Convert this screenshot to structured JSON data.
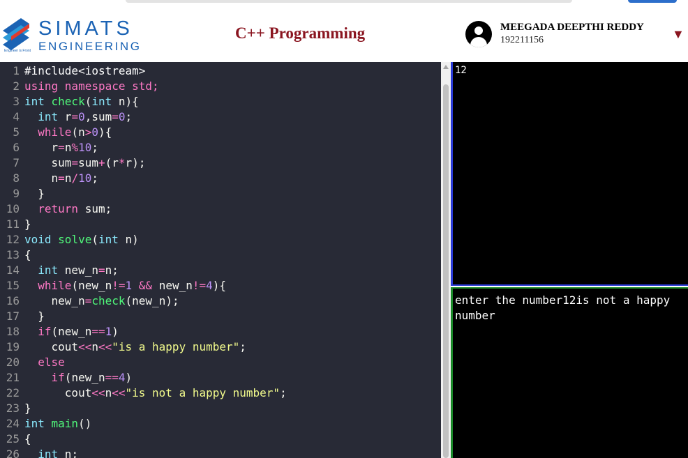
{
  "header": {
    "brand": "SIMATS",
    "brand_sub": "ENGINEERING",
    "tagline": "Engineer is Front",
    "title": "C++ Programming",
    "user_name": "MEEGADA DEEPTHI REDDY",
    "user_id": "192211156",
    "caret": "▼"
  },
  "editor": {
    "lines": [
      [
        [
          "#include<iostream>",
          "pp"
        ]
      ],
      [
        [
          "using namespace std;",
          "k"
        ]
      ],
      [
        [
          "int ",
          "t"
        ],
        [
          "check",
          "f"
        ],
        [
          "(",
          "w"
        ],
        [
          "int ",
          "t"
        ],
        [
          "n",
          "w"
        ],
        [
          "){",
          "w"
        ]
      ],
      [
        [
          "  int ",
          "t"
        ],
        [
          "r",
          "w"
        ],
        [
          "=",
          "k"
        ],
        [
          "0",
          "n"
        ],
        [
          ",",
          "w"
        ],
        [
          "sum",
          "w"
        ],
        [
          "=",
          "k"
        ],
        [
          "0",
          "n"
        ],
        [
          ";",
          "w"
        ]
      ],
      [
        [
          "  while",
          "k"
        ],
        [
          "(",
          "w"
        ],
        [
          "n",
          "w"
        ],
        [
          ">",
          "k"
        ],
        [
          "0",
          "n"
        ],
        [
          "){",
          "w"
        ]
      ],
      [
        [
          "    r",
          "w"
        ],
        [
          "=",
          "k"
        ],
        [
          "n",
          "w"
        ],
        [
          "%",
          "k"
        ],
        [
          "10",
          "n"
        ],
        [
          ";",
          "w"
        ]
      ],
      [
        [
          "    sum",
          "w"
        ],
        [
          "=",
          "k"
        ],
        [
          "sum",
          "w"
        ],
        [
          "+",
          "k"
        ],
        [
          "(",
          "w"
        ],
        [
          "r",
          "w"
        ],
        [
          "*",
          "k"
        ],
        [
          "r",
          "w"
        ],
        [
          ");",
          "w"
        ]
      ],
      [
        [
          "    n",
          "w"
        ],
        [
          "=",
          "k"
        ],
        [
          "n",
          "w"
        ],
        [
          "/",
          "k"
        ],
        [
          "10",
          "n"
        ],
        [
          ";",
          "w"
        ]
      ],
      [
        [
          "  }",
          "w"
        ]
      ],
      [
        [
          "  return ",
          "k"
        ],
        [
          "sum",
          "w"
        ],
        [
          ";",
          "w"
        ]
      ],
      [
        [
          "}",
          "w"
        ]
      ],
      [
        [
          "void ",
          "t"
        ],
        [
          "solve",
          "f"
        ],
        [
          "(",
          "w"
        ],
        [
          "int ",
          "t"
        ],
        [
          "n",
          "w"
        ],
        [
          ")",
          "w"
        ]
      ],
      [
        [
          "{",
          "w"
        ]
      ],
      [
        [
          "  int ",
          "t"
        ],
        [
          "new_n",
          "w"
        ],
        [
          "=",
          "k"
        ],
        [
          "n",
          "w"
        ],
        [
          ";",
          "w"
        ]
      ],
      [
        [
          "  while",
          "k"
        ],
        [
          "(",
          "w"
        ],
        [
          "new_n",
          "w"
        ],
        [
          "!=",
          "k"
        ],
        [
          "1 ",
          "n"
        ],
        [
          "&& ",
          "k"
        ],
        [
          "new_n",
          "w"
        ],
        [
          "!=",
          "k"
        ],
        [
          "4",
          "n"
        ],
        [
          "){",
          "w"
        ]
      ],
      [
        [
          "    new_n",
          "w"
        ],
        [
          "=",
          "k"
        ],
        [
          "check",
          "f"
        ],
        [
          "(",
          "w"
        ],
        [
          "new_n",
          "w"
        ],
        [
          ");",
          "w"
        ]
      ],
      [
        [
          "  }",
          "w"
        ]
      ],
      [
        [
          "  if",
          "k"
        ],
        [
          "(",
          "w"
        ],
        [
          "new_n",
          "w"
        ],
        [
          "==",
          "k"
        ],
        [
          "1",
          "n"
        ],
        [
          ")",
          "w"
        ]
      ],
      [
        [
          "    cout",
          "w"
        ],
        [
          "<<",
          "k"
        ],
        [
          "n",
          "w"
        ],
        [
          "<<",
          "k"
        ],
        [
          "\"is a happy number\"",
          "s"
        ],
        [
          ";",
          "w"
        ]
      ],
      [
        [
          "  else",
          "k"
        ]
      ],
      [
        [
          "    if",
          "k"
        ],
        [
          "(",
          "w"
        ],
        [
          "new_n",
          "w"
        ],
        [
          "==",
          "k"
        ],
        [
          "4",
          "n"
        ],
        [
          ")",
          "w"
        ]
      ],
      [
        [
          "      cout",
          "w"
        ],
        [
          "<<",
          "k"
        ],
        [
          "n",
          "w"
        ],
        [
          "<<",
          "k"
        ],
        [
          "\"is not a happy number\"",
          "s"
        ],
        [
          ";",
          "w"
        ]
      ],
      [
        [
          "}",
          "w"
        ]
      ],
      [
        [
          "int ",
          "t"
        ],
        [
          "main",
          "f"
        ],
        [
          "()",
          "w"
        ]
      ],
      [
        [
          "{",
          "w"
        ]
      ],
      [
        [
          "  int ",
          "t"
        ],
        [
          "n",
          "w"
        ],
        [
          ";",
          "w"
        ]
      ]
    ]
  },
  "input": {
    "value": "12"
  },
  "output": {
    "text": "enter the number12is not a happy number"
  },
  "colors": {
    "brand": "#1b63b4",
    "title": "#8a1520",
    "input_border": "#2a3bd6",
    "output_border": "#1b8a2a"
  }
}
